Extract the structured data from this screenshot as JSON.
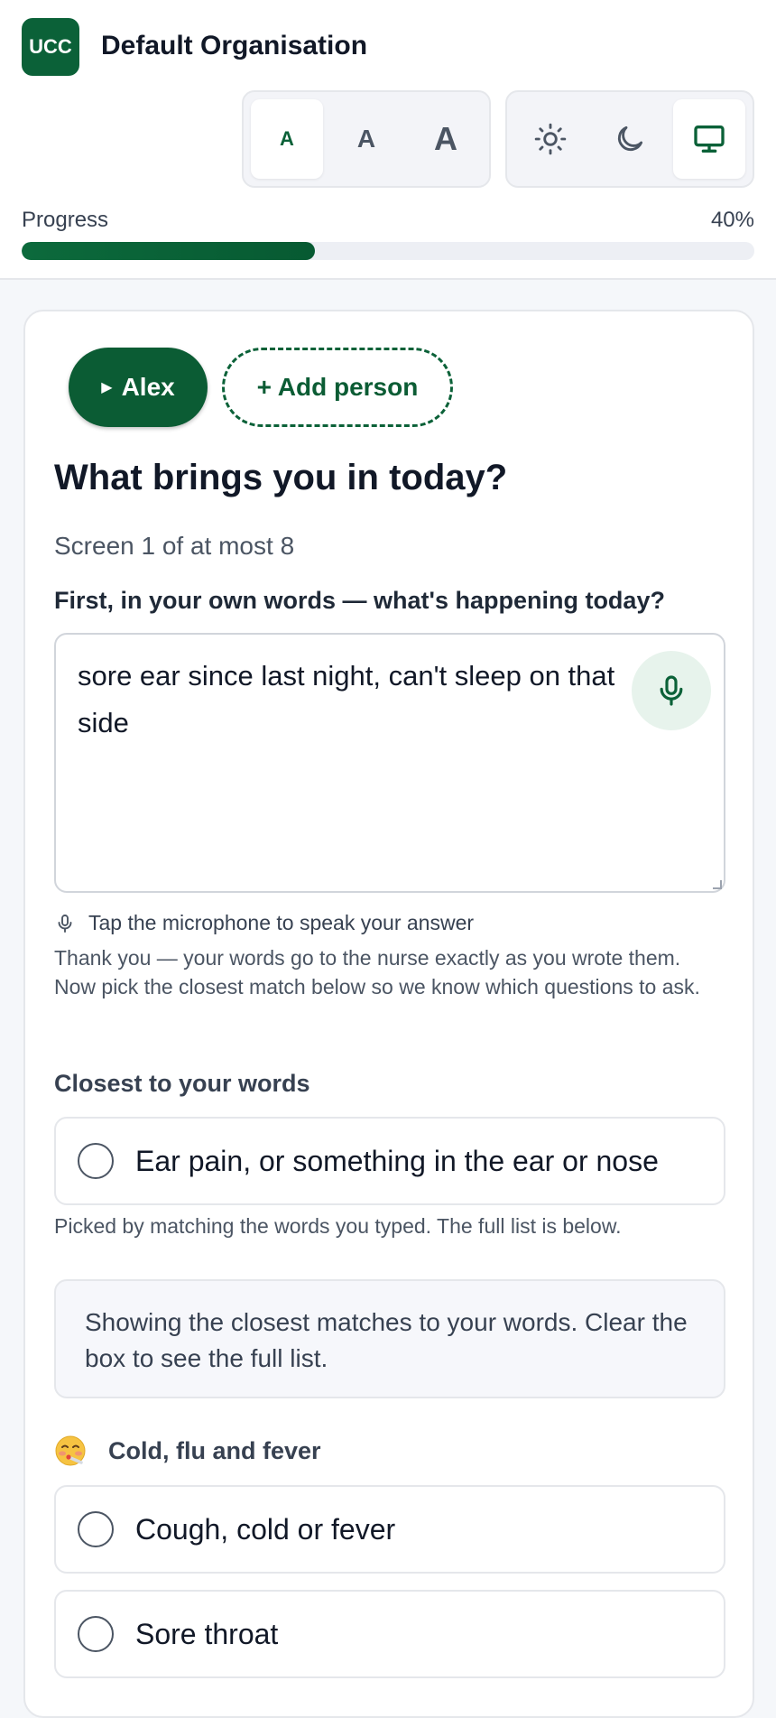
{
  "header": {
    "org_logo": "UCC",
    "org_name": "Default Organisation",
    "text_size_options": [
      "A",
      "A",
      "A"
    ],
    "text_size_selected": 0,
    "theme_options": [
      "sun-icon",
      "moon-icon",
      "monitor-icon"
    ],
    "theme_selected": 2
  },
  "progress": {
    "label": "Progress",
    "percent_label": "40%",
    "value": 0.4
  },
  "people": {
    "current": "Alex",
    "add_label": "+ Add person"
  },
  "question": {
    "title": "What brings you in today?",
    "screen_count": "Screen 1 of at most 8",
    "field_label": "First, in your own words — what's happening today?",
    "answer": "sore ear since last night, can't sleep on that side",
    "mic_hint": "Tap the microphone to speak your answer",
    "thanks": "Thank you — your words go to the nurse exactly as you wrote them. Now pick the closest match below so we know which questions to ask."
  },
  "closest": {
    "heading": "Closest to your words",
    "options": [
      {
        "label": "Ear pain, or something in the ear or nose",
        "selected": false
      }
    ],
    "note": "Picked by matching the words you typed. The full list is below."
  },
  "info": "Showing the closest matches to your words. Clear the box to see the full list.",
  "category": {
    "emoji": "face-with-thermometer-icon",
    "heading": "Cold, flu and fever",
    "options": [
      {
        "label": "Cough, cold or fever",
        "selected": false
      },
      {
        "label": "Sore throat",
        "selected": false
      }
    ]
  },
  "colors": {
    "brand": "#0b6138",
    "brand_light": "#e7f3ec",
    "border": "#e5e7eb",
    "muted_text": "#4b5563"
  }
}
